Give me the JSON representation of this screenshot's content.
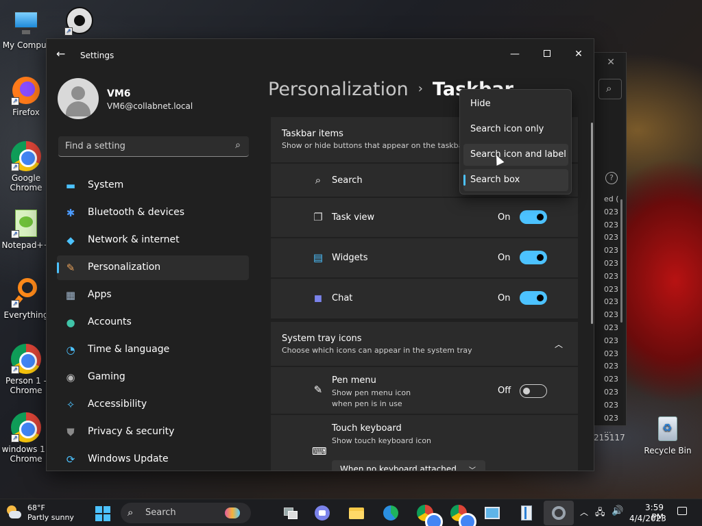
{
  "desktop": {
    "icons": [
      {
        "label": "My Comput",
        "icon": "computer-icon"
      },
      {
        "label": "",
        "icon": "obs-icon"
      },
      {
        "label": "Firefox",
        "icon": "firefox-icon"
      },
      {
        "label": "Google Chrome",
        "icon": "chrome-icon"
      },
      {
        "label": "Notepad++",
        "icon": "notepadpp-icon"
      },
      {
        "label": "Everything",
        "icon": "everything-icon"
      },
      {
        "label": "Person 1 - Chrome",
        "icon": "chrome-icon"
      },
      {
        "label": "windows 11 Chrome",
        "icon": "chrome-icon"
      },
      {
        "label": "Recycle Bin",
        "icon": "recycle-bin-icon"
      }
    ],
    "background_window": {
      "column_header": "ed (",
      "rows": [
        "023",
        "023",
        "023",
        "023",
        "023",
        "023",
        "023",
        "023",
        "023",
        "023",
        "023",
        "023",
        "023",
        "023",
        "023",
        "023",
        "023",
        "..."
      ],
      "footer_number": "215117"
    }
  },
  "settings": {
    "title": "Settings",
    "controls": {
      "minimize": "—",
      "maximize": "",
      "close": "✕"
    },
    "user": {
      "name": "VM6",
      "email": "VM6@collabnet.local"
    },
    "search": {
      "placeholder": "Find a setting"
    },
    "nav": [
      {
        "label": "System",
        "icon": "system-icon",
        "color": "#4cc2ff",
        "glyph": "▬"
      },
      {
        "label": "Bluetooth & devices",
        "icon": "bluetooth-icon",
        "color": "#4c9bff",
        "glyph": "✱"
      },
      {
        "label": "Network & internet",
        "icon": "wifi-icon",
        "color": "#4cc2ff",
        "glyph": "◆"
      },
      {
        "label": "Personalization",
        "icon": "brush-icon",
        "color": "#e8a15a",
        "glyph": "✎",
        "active": true
      },
      {
        "label": "Apps",
        "icon": "apps-icon",
        "color": "#9fb4c9",
        "glyph": "▦"
      },
      {
        "label": "Accounts",
        "icon": "accounts-icon",
        "color": "#40c4a8",
        "glyph": "●"
      },
      {
        "label": "Time & language",
        "icon": "clock-globe-icon",
        "color": "#4cc2ff",
        "glyph": "◔"
      },
      {
        "label": "Gaming",
        "icon": "gamepad-icon",
        "color": "#b8b8b8",
        "glyph": "◉"
      },
      {
        "label": "Accessibility",
        "icon": "accessibility-icon",
        "color": "#4cc2ff",
        "glyph": "✧"
      },
      {
        "label": "Privacy & security",
        "icon": "shield-icon",
        "color": "#8a8a8a",
        "glyph": "⛊"
      },
      {
        "label": "Windows Update",
        "icon": "update-icon",
        "color": "#4cc2ff",
        "glyph": "⟳"
      }
    ],
    "breadcrumb": {
      "parent": "Personalization",
      "separator": "›",
      "current": "Taskbar"
    },
    "taskbar_items": {
      "title": "Taskbar items",
      "subtitle": "Show or hide buttons that appear on the taskbar",
      "rows": [
        {
          "label": "Search",
          "icon": "search-icon"
        },
        {
          "label": "Task view",
          "icon": "task-view-icon",
          "state": "On",
          "on": true
        },
        {
          "label": "Widgets",
          "icon": "widgets-icon",
          "state": "On",
          "on": true
        },
        {
          "label": "Chat",
          "icon": "chat-icon",
          "state": "On",
          "on": true
        }
      ]
    },
    "system_tray": {
      "title": "System tray icons",
      "subtitle": "Choose which icons can appear in the system tray",
      "pen_menu": {
        "label": "Pen menu",
        "sub1": "Show pen menu icon",
        "sub2": "when pen is in use",
        "state": "Off"
      },
      "touch_keyboard": {
        "label": "Touch keyboard",
        "sub": "Show touch keyboard icon",
        "dropdown": "When no keyboard attached"
      }
    },
    "search_menu": {
      "options": [
        "Hide",
        "Search icon only",
        "Search icon and label",
        "Search box"
      ],
      "selected": "Search box",
      "hovered": "Search icon and label"
    }
  },
  "taskbar": {
    "weather": {
      "temp": "68°F",
      "desc": "Partly sunny"
    },
    "search_label": "Search",
    "clock": {
      "time": "3:59 PM",
      "date": "4/4/2023"
    },
    "apps": [
      "task-view-icon",
      "teams-chat-icon",
      "file-explorer-icon",
      "edge-icon",
      "chrome-icon",
      "chrome-icon",
      "control-panel-icon",
      "notepad-icon",
      "settings-icon"
    ]
  },
  "colors": {
    "accent": "#4cc2ff",
    "window_bg": "#202020",
    "card_bg": "#2b2b2b"
  }
}
